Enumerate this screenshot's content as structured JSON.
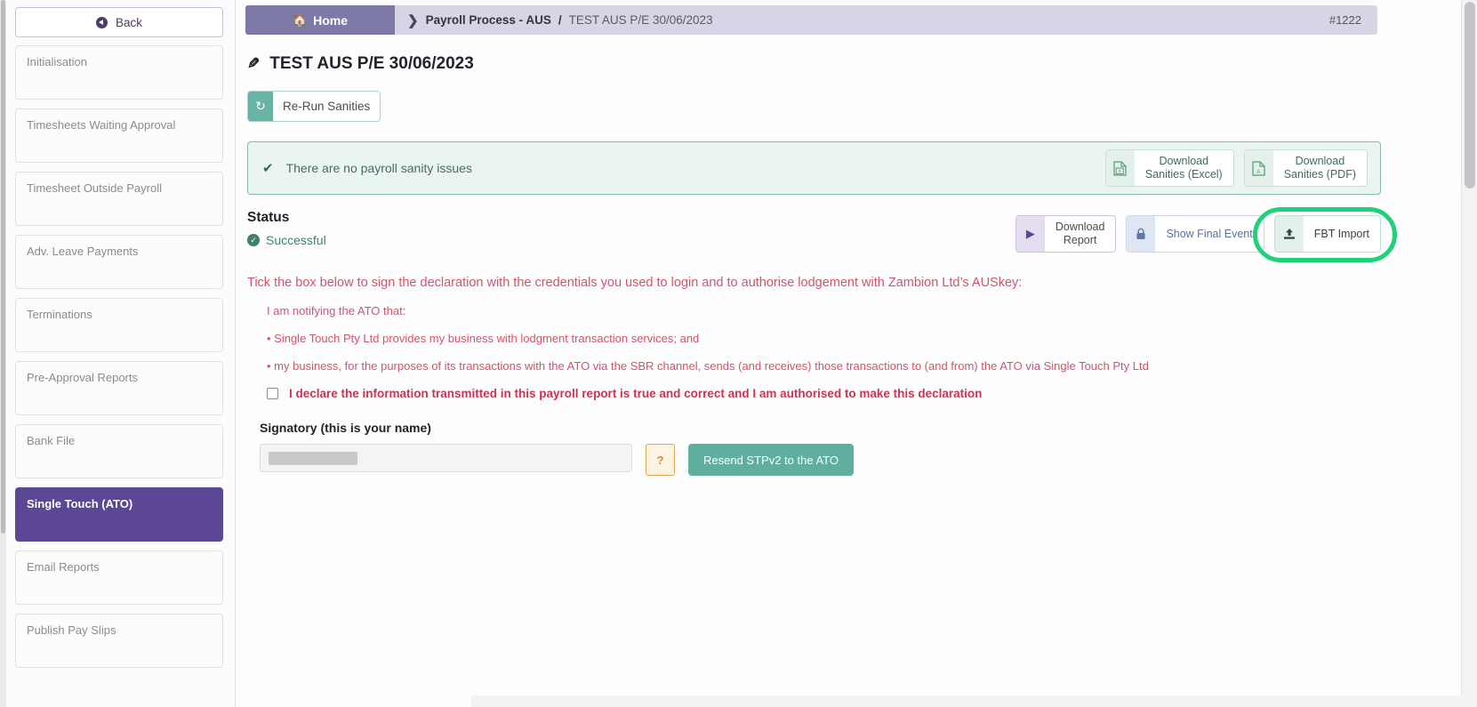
{
  "sidebar": {
    "back_label": "Back",
    "back_icon": "arrow-circle-left-icon",
    "items": [
      {
        "label": "Initialisation",
        "active": false
      },
      {
        "label": "Timesheets Waiting Approval",
        "active": false
      },
      {
        "label": "Timesheet Outside Payroll",
        "active": false
      },
      {
        "label": "Adv. Leave Payments",
        "active": false
      },
      {
        "label": "Terminations",
        "active": false
      },
      {
        "label": "Pre-Approval Reports",
        "active": false
      },
      {
        "label": "Bank File",
        "active": false
      },
      {
        "label": "Single Touch (ATO)",
        "active": true
      },
      {
        "label": "Email Reports",
        "active": false
      },
      {
        "label": "Publish Pay Slips",
        "active": false
      }
    ]
  },
  "breadcrumb": {
    "home_label": "Home",
    "home_icon": "home-icon",
    "chevron_icon": "chevron-right-icon",
    "parent": "Payroll Process - AUS",
    "separator": "/",
    "current": "TEST AUS P/E 30/06/2023",
    "record_id": "#1222"
  },
  "page": {
    "title": "TEST AUS P/E 30/06/2023",
    "title_icon": "pencil-icon"
  },
  "toolbar": {
    "rerun_label": "Re-Run Sanities",
    "rerun_icon": "refresh-icon"
  },
  "sanity": {
    "check_icon": "check-icon",
    "message": "There are no payroll sanity issues",
    "excel_label": "Download\nSanities (Excel)",
    "excel_icon": "file-excel-icon",
    "pdf_label": "Download\nSanities (PDF)",
    "pdf_icon": "file-pdf-icon"
  },
  "status": {
    "heading": "Status",
    "value": "Successful",
    "value_icon": "check-circle-icon",
    "actions": [
      {
        "label": "Download\nReport",
        "icon": "play-icon",
        "style": "purple",
        "name": "download-report-button"
      },
      {
        "label": "Show Final Event",
        "icon": "lock-icon",
        "style": "blue",
        "name": "show-final-event-button"
      },
      {
        "label": "FBT Import",
        "icon": "upload-icon",
        "style": "green",
        "name": "fbt-import-button",
        "highlighted": true
      }
    ],
    "highlight_color": "#21d07a"
  },
  "declaration": {
    "heading": "Tick the box below to sign the declaration with the credentials you used to login and to authorise lodgement with Zambion Ltd’s AUSkey:",
    "intro": "I am notifying the ATO that:",
    "bullet_1": "• Single Touch Pty Ltd provides my business with lodgment transaction services; and",
    "bullet_2": "• my business, for the purposes of its transactions with the ATO via the SBR channel, sends (and receives) those transactions to (and from) the ATO via Single Touch Pty Ltd",
    "checkbox_label": "I declare the information transmitted in this payroll report is true and correct and I am authorised to make this declaration",
    "checkbox_checked": false,
    "text_color": "#d4536c",
    "strong_color": "#cc3355"
  },
  "signatory": {
    "label": "Signatory (this is your name)",
    "value": "",
    "placeholder": "",
    "help_label": "?",
    "resend_label": "Resend STPv2 to the ATO"
  }
}
